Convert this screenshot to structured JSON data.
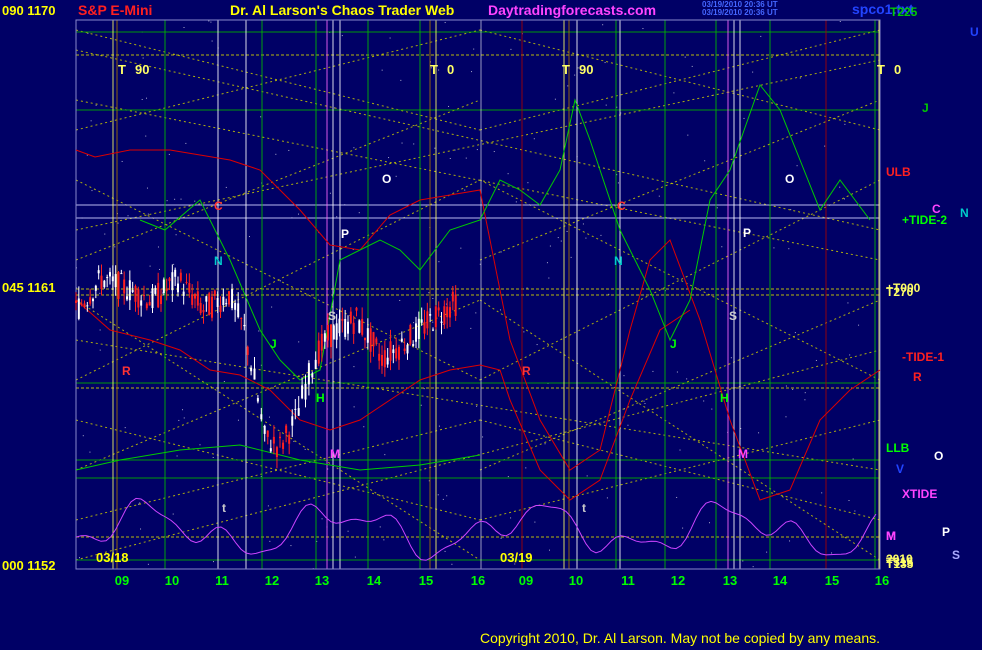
{
  "header": {
    "symbol_title": "S&P E-Mini",
    "site_title": "Dr. Al Larson's Chaos Trader Web",
    "site_url": "Daytradingforecasts.com",
    "corner_file": "spco1.txt",
    "date_line1": "03/19/2010 20:36 UT",
    "date_line2": "03/19/2010 20:36 UT"
  },
  "colors": {
    "background": "#000066",
    "grid_green": "#00aa00",
    "grid_yellow": "#cccc00",
    "red_curve": "#dd0000",
    "green_curve": "#00cc00",
    "magenta_curve": "#cc44ff",
    "price_up": "#ffffff",
    "price_down": "#ff2020"
  },
  "chart_data": {
    "type": "line",
    "title": "S&P E-Mini",
    "ylim": [
      1152,
      1170
    ],
    "price_axis": [
      {
        "code": "090",
        "price": "1170"
      },
      {
        "code": "045",
        "price": "1161"
      },
      {
        "code": "000",
        "price": "1152"
      }
    ],
    "hour_ticks": [
      "09",
      "10",
      "11",
      "12",
      "13",
      "14",
      "15",
      "16",
      "09",
      "10",
      "11",
      "12",
      "13",
      "14",
      "15",
      "16"
    ],
    "dates": [
      "03/18",
      "03/19"
    ],
    "t_markers": [
      {
        "label": "T",
        "value": "90"
      },
      {
        "label": "T",
        "value": "0"
      },
      {
        "label": "T",
        "value": "90"
      },
      {
        "label": "T",
        "value": "0"
      }
    ],
    "right_labels": [
      "T225",
      "U",
      "J",
      "ULB",
      "C",
      "N",
      "+TIDE-2",
      "+T000",
      "T270",
      "-TIDE-1",
      "R",
      "LLB",
      "O",
      "V",
      "XTIDE",
      "P",
      "M",
      "S",
      "2010",
      "T315",
      "T135"
    ],
    "chart_letters": [
      "C",
      "N",
      "O",
      "P",
      "S",
      "J",
      "H",
      "M",
      "R",
      "t",
      "C",
      "N",
      "O",
      "P",
      "S",
      "J",
      "H",
      "M",
      "R",
      "t",
      "M"
    ],
    "series": [
      {
        "name": "price",
        "x": [
          8.5,
          9.0,
          9.5,
          10.0,
          10.5,
          11.0,
          11.5,
          11.8,
          12.0,
          12.2,
          12.5,
          12.8,
          13.0,
          13.2,
          13.5,
          14.0,
          14.5,
          15.0,
          15.5,
          16.0
        ],
        "values": [
          1160.5,
          1161.5,
          1161.2,
          1160.8,
          1161.5,
          1160.5,
          1161.0,
          1159.8,
          1158.2,
          1156.3,
          1156.0,
          1156.9,
          1158.0,
          1159.0,
          1159.7,
          1160.2,
          1158.9,
          1159.5,
          1160.2,
          1160.8
        ]
      }
    ]
  }
}
